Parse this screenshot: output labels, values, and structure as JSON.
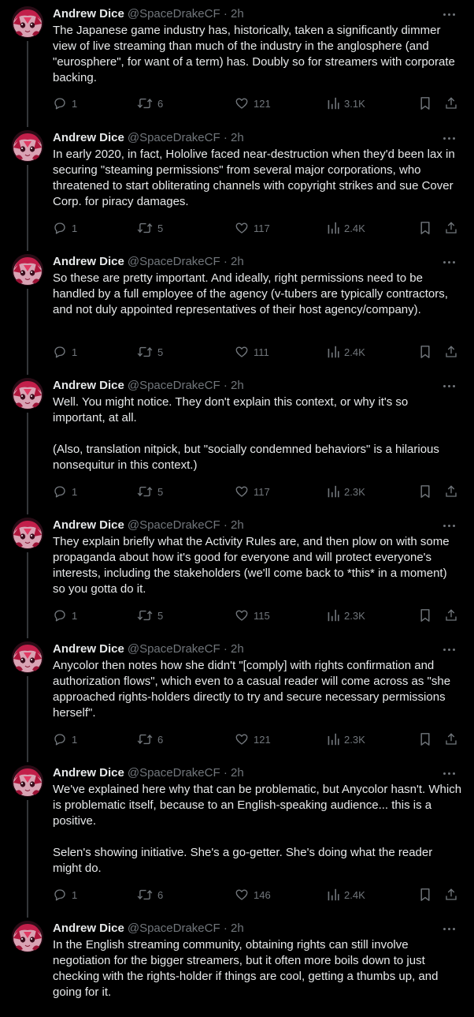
{
  "author": {
    "name": "Andrew Dice",
    "handle": "@SpaceDrakeCF",
    "separator": "·"
  },
  "colors": {
    "background": "#000000",
    "text": "#e7e9ea",
    "secondary": "#71767b",
    "thread_line": "#333639"
  },
  "icons": {
    "reply": "reply-icon",
    "retweet": "retweet-icon",
    "like": "like-icon",
    "views": "views-icon",
    "bookmark": "bookmark-icon",
    "share": "share-icon",
    "more": "more-icon"
  },
  "tweets": [
    {
      "time": "2h",
      "text": "The Japanese game industry has, historically, taken a significantly dimmer view of live streaming than much of the industry in the anglosphere (and \"eurosphere\", for want of a term) has. Doubly so for streamers with corporate backing.",
      "replies": "1",
      "retweets": "6",
      "likes": "121",
      "views": "3.1K"
    },
    {
      "time": "2h",
      "text": "In early 2020, in fact, Hololive faced near-destruction when they'd been lax in securing \"steaming permissions\" from several major corporations, who threatened to start obliterating channels with copyright strikes and sue Cover Corp. for piracy damages.",
      "replies": "1",
      "retweets": "5",
      "likes": "117",
      "views": "2.4K"
    },
    {
      "time": "2h",
      "text": "So these are pretty important. And ideally, right permissions need to be handled by a full employee of the agency (v-tubers are typically contractors, and not duly appointed representatives of their host agency/company).",
      "replies": "1",
      "retweets": "5",
      "likes": "111",
      "views": "2.4K"
    },
    {
      "time": "2h",
      "text": "Well. You might notice. They don't explain this context, or why it's so important, at all.\n\n(Also, translation nitpick, but \"socially condemned behaviors\" is a hilarious nonsequitur in this context.)",
      "replies": "1",
      "retweets": "5",
      "likes": "117",
      "views": "2.3K"
    },
    {
      "time": "2h",
      "text": "They explain briefly what the Activity Rules are, and then plow on with some propaganda about how it's good for everyone and will protect everyone's interests, including the stakeholders (we'll come back to *this* in a moment) so you gotta do it.",
      "replies": "1",
      "retweets": "5",
      "likes": "115",
      "views": "2.3K"
    },
    {
      "time": "2h",
      "text": "Anycolor then notes how she didn't \"[comply] with rights confirmation and authorization flows\", which even to a casual reader will come across as \"she approached rights-holders directly to try and secure necessary permissions herself\".",
      "replies": "1",
      "retweets": "6",
      "likes": "121",
      "views": "2.3K"
    },
    {
      "time": "2h",
      "text": "We've explained here why that can be problematic, but Anycolor hasn't. Which is problematic itself, because to an English-speaking audience... this is a positive.\n\nSelen's showing initiative. She's a go-getter. She's doing what the reader might do.",
      "replies": "1",
      "retweets": "6",
      "likes": "146",
      "views": "2.4K"
    },
    {
      "time": "2h",
      "text": "In the English streaming community, obtaining rights can still involve negotiation for the bigger streamers, but it often more boils down to just checking with the rights-holder if things are cool, getting a thumbs up, and going for it.",
      "replies": "",
      "retweets": "",
      "likes": "",
      "views": ""
    }
  ]
}
